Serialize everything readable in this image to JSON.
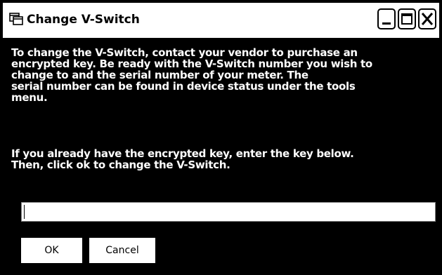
{
  "window": {
    "title": "Change V-Switch",
    "icon": "dialog-window-icon",
    "controls": {
      "minimize": "minimize-icon",
      "maximize": "maximize-icon",
      "close": "close-icon"
    }
  },
  "message": {
    "paragraph1": [
      "To change the V-Switch, contact your vendor to purchase an",
      "encrypted key.  Be ready with the V-Switch number you wish to",
      "change to and the serial number of your meter.   The",
      "serial number can be found in device status under the tools",
      "menu."
    ],
    "paragraph2": [
      "If you already have the encrypted key, enter the key below.",
      "Then, click ok to change the V-Switch."
    ]
  },
  "key_input": {
    "value": ""
  },
  "buttons": {
    "ok_label": "OK",
    "cancel_label": "Cancel"
  },
  "colors": {
    "background": "#000000",
    "text": "#ffffff",
    "titlebar": "#ffffff"
  }
}
